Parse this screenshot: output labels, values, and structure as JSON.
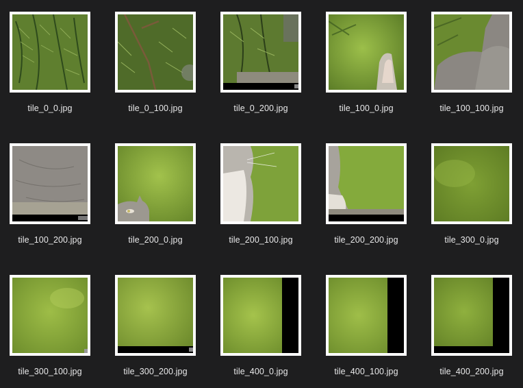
{
  "files": [
    {
      "name": "tile_0_0.jpg",
      "thumb": "pine-branches-1"
    },
    {
      "name": "tile_0_100.jpg",
      "thumb": "pine-branches-2"
    },
    {
      "name": "tile_0_200.jpg",
      "thumb": "pine-branches-3"
    },
    {
      "name": "tile_100_0.jpg",
      "thumb": "green-cat-ear"
    },
    {
      "name": "tile_100_100.jpg",
      "thumb": "cat-back"
    },
    {
      "name": "tile_100_200.jpg",
      "thumb": "cat-body"
    },
    {
      "name": "tile_200_0.jpg",
      "thumb": "cat-face"
    },
    {
      "name": "tile_200_100.jpg",
      "thumb": "cat-chest"
    },
    {
      "name": "tile_200_200.jpg",
      "thumb": "cat-edge"
    },
    {
      "name": "tile_300_0.jpg",
      "thumb": "green-blur-1"
    },
    {
      "name": "tile_300_100.jpg",
      "thumb": "green-blur-2"
    },
    {
      "name": "tile_300_200.jpg",
      "thumb": "green-blur-3"
    },
    {
      "name": "tile_400_0.jpg",
      "thumb": "green-blur-black-right-1"
    },
    {
      "name": "tile_400_100.jpg",
      "thumb": "green-blur-black-right-2"
    },
    {
      "name": "tile_400_200.jpg",
      "thumb": "green-blur-black-corner"
    }
  ],
  "colors": {
    "background": "#1e1e1f",
    "frame": "#ffffff",
    "caption": "#e9e9ea"
  }
}
